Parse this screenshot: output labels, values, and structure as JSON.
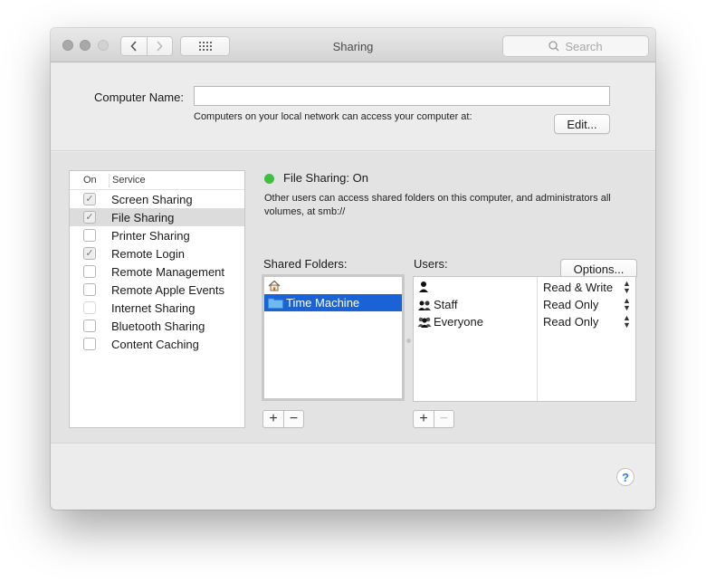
{
  "window": {
    "title": "Sharing",
    "search_placeholder": "Search"
  },
  "computer_name": {
    "label": "Computer Name:",
    "value": "",
    "subtitle": "Computers on your local network can access your computer at:",
    "edit_label": "Edit..."
  },
  "services": {
    "header_on": "On",
    "header_service": "Service",
    "items": [
      {
        "name": "Screen Sharing",
        "checked": true,
        "selected": false
      },
      {
        "name": "File Sharing",
        "checked": true,
        "selected": true
      },
      {
        "name": "Printer Sharing",
        "checked": false,
        "selected": false
      },
      {
        "name": "Remote Login",
        "checked": true,
        "selected": false
      },
      {
        "name": "Remote Management",
        "checked": false,
        "selected": false
      },
      {
        "name": "Remote Apple Events",
        "checked": false,
        "selected": false
      },
      {
        "name": "Internet Sharing",
        "checked": false,
        "selected": false,
        "disabled": true
      },
      {
        "name": "Bluetooth Sharing",
        "checked": false,
        "selected": false
      },
      {
        "name": "Content Caching",
        "checked": false,
        "selected": false
      }
    ]
  },
  "detail": {
    "status": "File Sharing: On",
    "status_color": "#3fbf3f",
    "description": "Other users can access shared folders on this computer, and administrators all volumes, at smb://",
    "options_label": "Options...",
    "shared_folders_label": "Shared Folders:",
    "users_label": "Users:",
    "folders": [
      {
        "name": "",
        "icon": "home-icon",
        "selected": false
      },
      {
        "name": "Time Machine",
        "icon": "folder-icon",
        "selected": true
      }
    ],
    "users": [
      {
        "name": "",
        "icon": "user-icon",
        "permission": "Read & Write"
      },
      {
        "name": "Staff",
        "icon": "group-icon",
        "permission": "Read Only"
      },
      {
        "name": "Everyone",
        "icon": "everyone-icon",
        "permission": "Read Only"
      }
    ]
  },
  "buttons": {
    "plus": "+",
    "minus": "−",
    "help": "?"
  }
}
